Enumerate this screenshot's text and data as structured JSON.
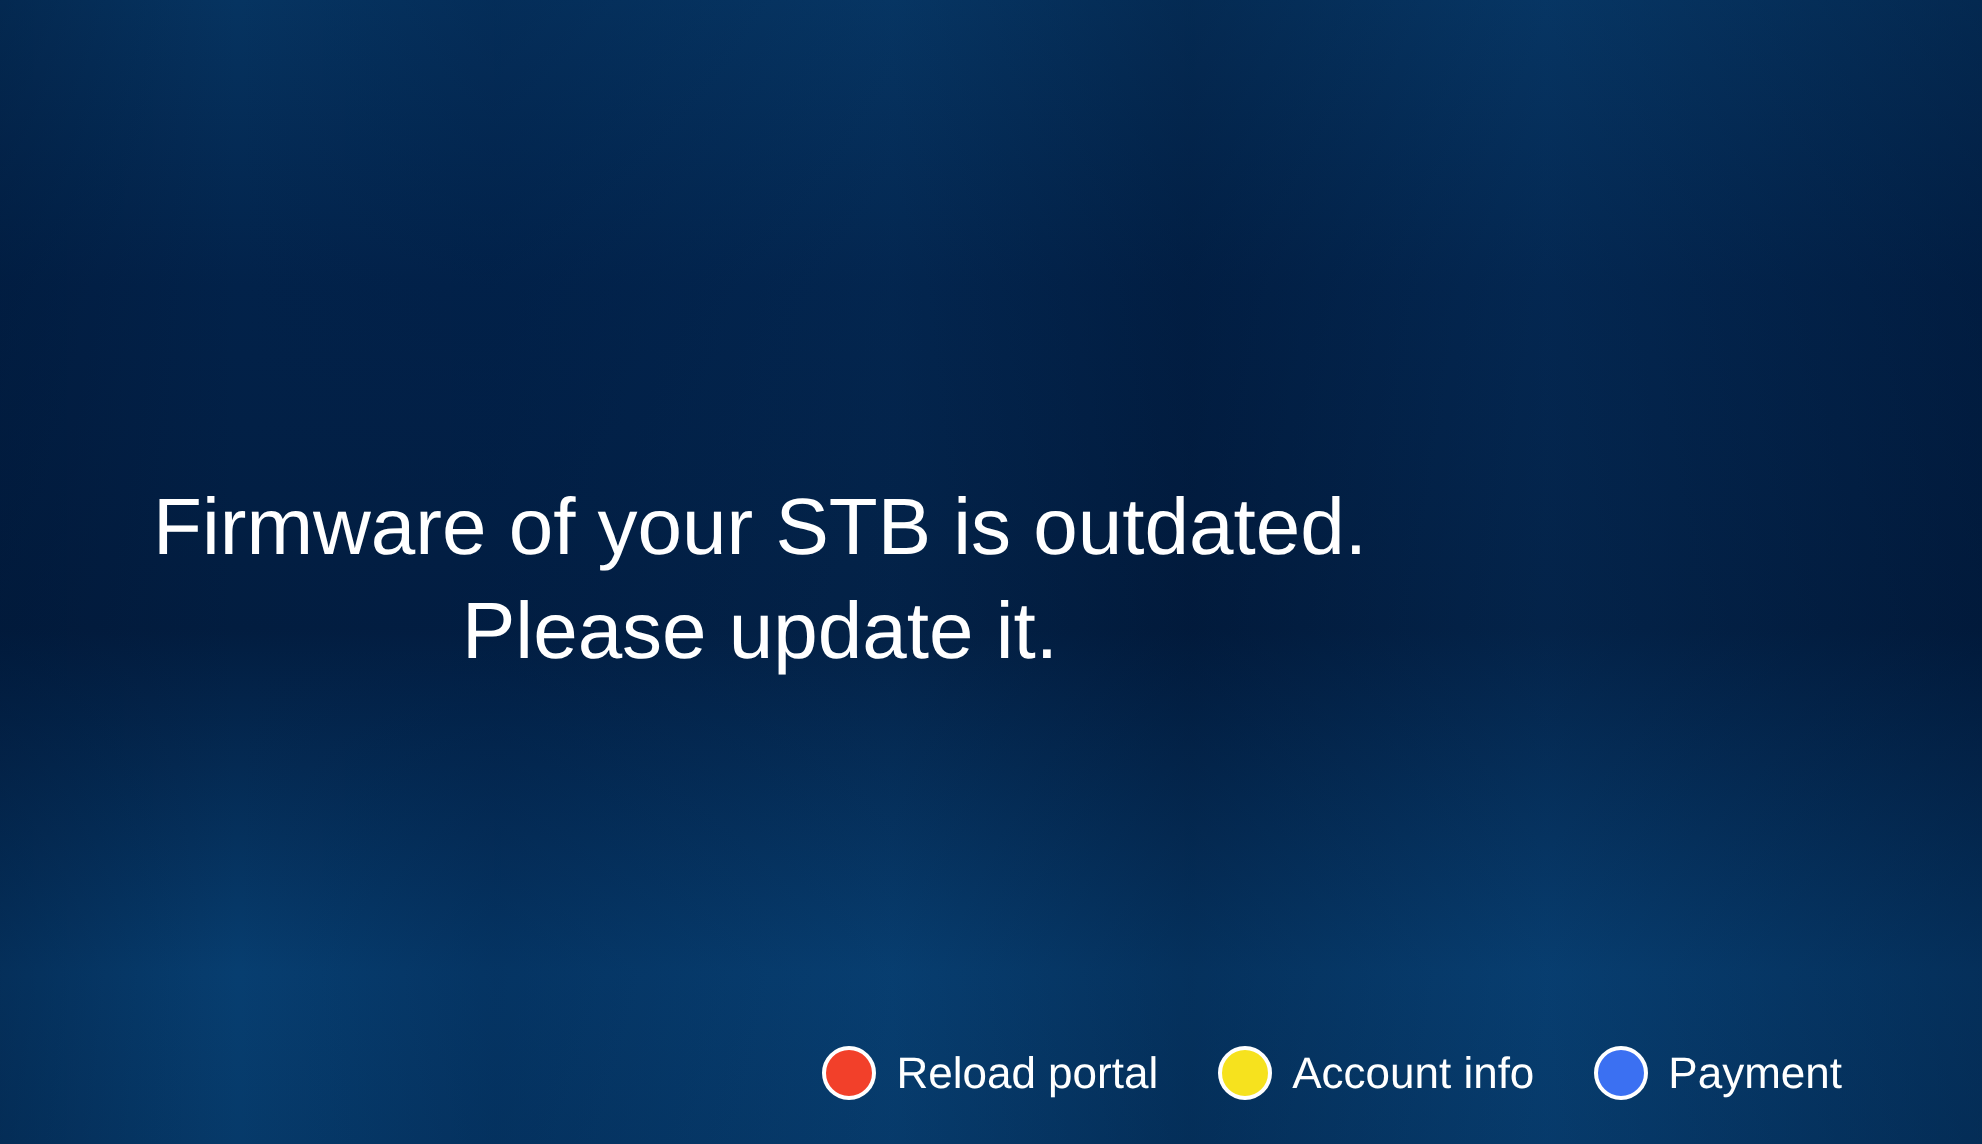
{
  "message": {
    "lines": [
      "Firmware of your STB is outdated.",
      "Please update it."
    ]
  },
  "hints": [
    {
      "label": "Reload portal",
      "color": "#f2402a"
    },
    {
      "label": "Account info",
      "color": "#f6e21e"
    },
    {
      "label": "Payment",
      "color": "#3b70f2"
    }
  ]
}
